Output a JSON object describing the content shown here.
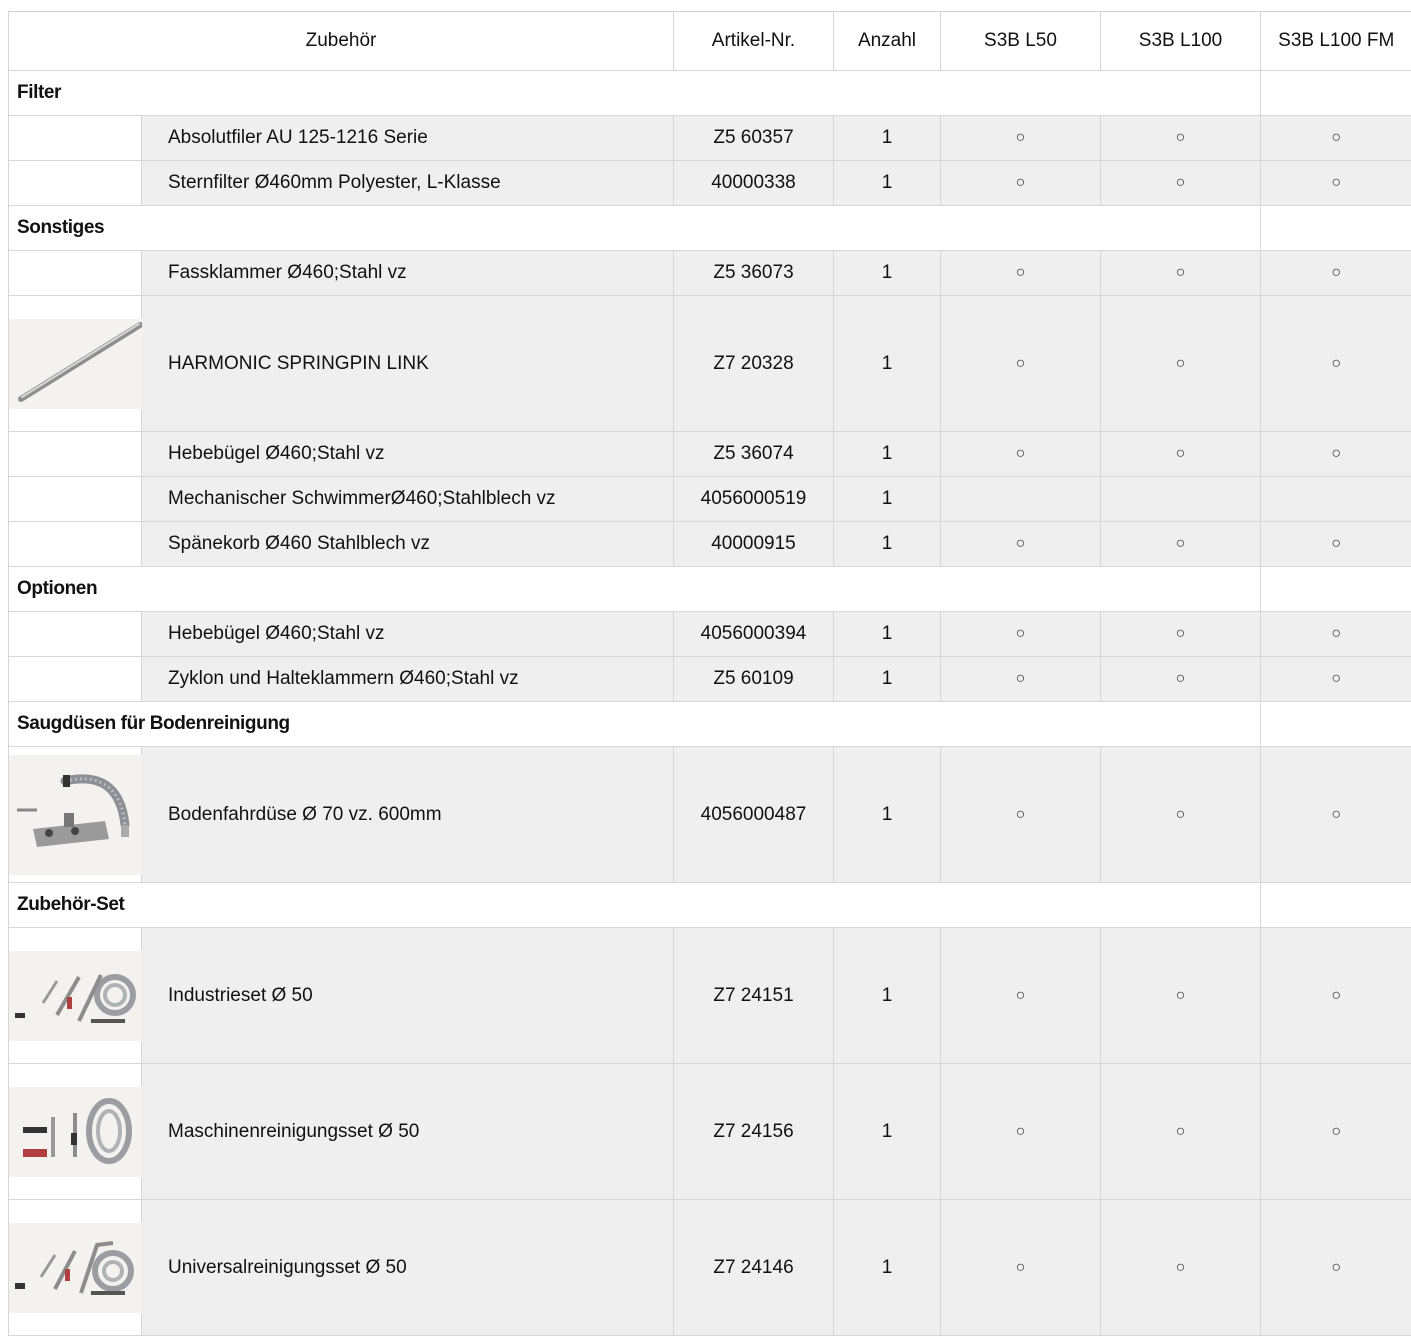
{
  "headers": {
    "zubehoer": "Zubehör",
    "artikel": "Artikel-Nr.",
    "anzahl": "Anzahl",
    "m1": "S3B L50",
    "m2": "S3B L100",
    "m3": "S3B L100 FM"
  },
  "sections": {
    "filter": {
      "title": "Filter",
      "items": [
        {
          "name": "Absolutfiler AU 125-1216 Serie",
          "art": "Z5 60357",
          "qty": "1",
          "m1": "○",
          "m2": "○",
          "m3": "○"
        },
        {
          "name": "Sternfilter Ø460mm Polyester, L-Klasse",
          "art": "40000338",
          "qty": "1",
          "m1": "○",
          "m2": "○",
          "m3": "○"
        }
      ]
    },
    "sonstiges": {
      "title": "Sonstiges",
      "items": [
        {
          "name": "Fassklammer Ø460;Stahl vz",
          "art": "Z5 36073",
          "qty": "1",
          "m1": "○",
          "m2": "○",
          "m3": "○"
        },
        {
          "name": "HARMONIC SPRINGPIN LINK",
          "art": "Z7 20328",
          "qty": "1",
          "m1": "○",
          "m2": "○",
          "m3": "○",
          "image": "springpin-rod"
        },
        {
          "name": "Hebebügel Ø460;Stahl vz",
          "art": "Z5 36074",
          "qty": "1",
          "m1": "○",
          "m2": "○",
          "m3": "○"
        },
        {
          "name": "Mechanischer SchwimmerØ460;Stahlblech vz",
          "art": "4056000519",
          "qty": "1",
          "m1": "",
          "m2": "",
          "m3": ""
        },
        {
          "name": "Spänekorb Ø460 Stahlblech vz",
          "art": "40000915",
          "qty": "1",
          "m1": "○",
          "m2": "○",
          "m3": "○"
        }
      ]
    },
    "optionen": {
      "title": "Optionen",
      "items": [
        {
          "name": "Hebebügel Ø460;Stahl vz",
          "art": "4056000394",
          "qty": "1",
          "m1": "○",
          "m2": "○",
          "m3": "○"
        },
        {
          "name": "Zyklon und Halteklammern Ø460;Stahl vz",
          "art": "Z5 60109",
          "qty": "1",
          "m1": "○",
          "m2": "○",
          "m3": "○"
        }
      ]
    },
    "saugduesen": {
      "title": "Saugdüsen für Bodenreinigung",
      "items": [
        {
          "name": "Bodenfahrdüse Ø 70 vz. 600mm",
          "art": "4056000487",
          "qty": "1",
          "m1": "○",
          "m2": "○",
          "m3": "○",
          "image": "floor-nozzle"
        }
      ]
    },
    "set": {
      "title": "Zubehör-Set",
      "items": [
        {
          "name": "Industrieset Ø 50",
          "art": "Z7 24151",
          "qty": "1",
          "m1": "○",
          "m2": "○",
          "m3": "○",
          "image": "accessory-set"
        },
        {
          "name": "Maschinenreinigungsset Ø 50",
          "art": "Z7 24156",
          "qty": "1",
          "m1": "○",
          "m2": "○",
          "m3": "○",
          "image": "machine-set"
        },
        {
          "name": "Universalreinigungsset Ø 50",
          "art": "Z7 24146",
          "qty": "1",
          "m1": "○",
          "m2": "○",
          "m3": "○",
          "image": "universal-set"
        }
      ]
    }
  }
}
